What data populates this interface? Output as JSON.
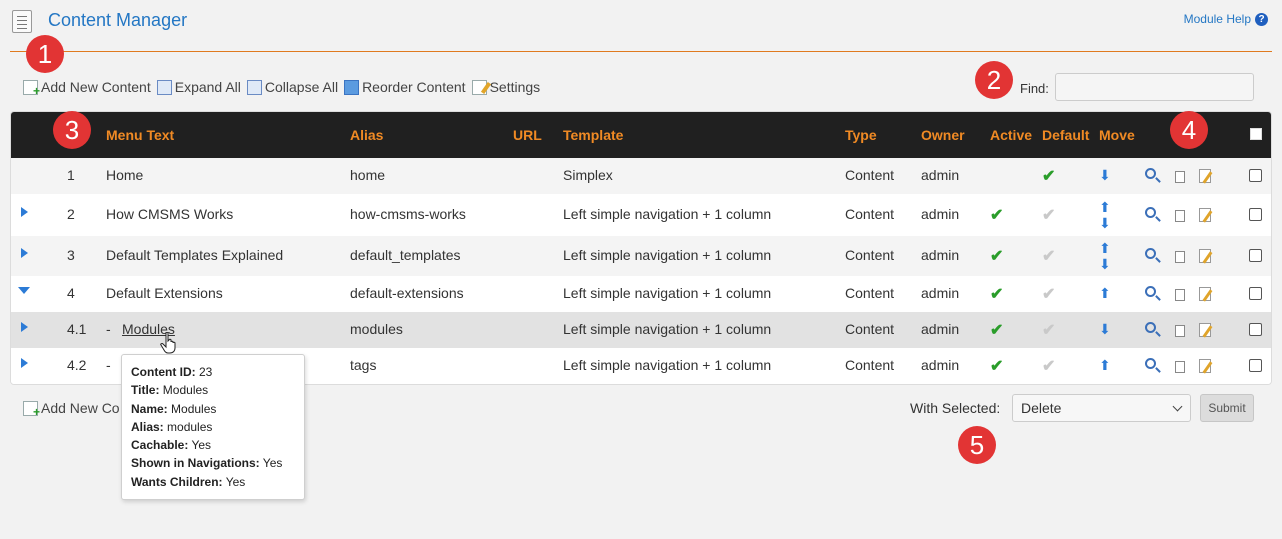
{
  "header": {
    "title": "Content Manager",
    "module_help": "Module Help",
    "help_icon": "?"
  },
  "callouts": [
    "1",
    "2",
    "3",
    "4",
    "5"
  ],
  "toolbar": {
    "add_new_content": "Add New Content",
    "expand_all": "Expand All",
    "collapse_all": "Collapse All",
    "reorder_content": "Reorder Content",
    "settings": "Settings"
  },
  "find": {
    "label": "Find:",
    "value": ""
  },
  "table": {
    "columns": [
      "Menu Text",
      "Alias",
      "URL",
      "Template",
      "Type",
      "Owner",
      "Active",
      "Default",
      "Move"
    ],
    "rows": [
      {
        "expander": "none",
        "num": "1",
        "prefix": "",
        "menu_text": "Home",
        "alias": "home",
        "template": "Simplex",
        "type": "Content",
        "owner": "admin",
        "active": "",
        "default": "on",
        "move": "down"
      },
      {
        "expander": "right",
        "num": "2",
        "prefix": "",
        "menu_text": "How CMSMS Works",
        "alias": "how-cmsms-works",
        "template": "Left simple navigation + 1 column",
        "type": "Content",
        "owner": "admin",
        "active": "on",
        "default": "off",
        "move": "updown"
      },
      {
        "expander": "right",
        "num": "3",
        "prefix": "",
        "menu_text": "Default Templates Explained",
        "alias": "default_templates",
        "template": "Left simple navigation + 1 column",
        "type": "Content",
        "owner": "admin",
        "active": "on",
        "default": "off",
        "move": "updown"
      },
      {
        "expander": "down",
        "num": "4",
        "prefix": "",
        "menu_text": "Default Extensions",
        "alias": "default-extensions",
        "template": "Left simple navigation + 1 column",
        "type": "Content",
        "owner": "admin",
        "active": "on",
        "default": "off",
        "move": "up"
      },
      {
        "expander": "right",
        "num": "4.1",
        "prefix": "-",
        "menu_text": "Modules",
        "alias": "modules",
        "template": "Left simple navigation + 1 column",
        "type": "Content",
        "owner": "admin",
        "active": "on",
        "default": "off",
        "move": "down"
      },
      {
        "expander": "right",
        "num": "4.2",
        "prefix": "-",
        "menu_text": "",
        "alias": "tags",
        "template": "Left simple navigation + 1 column",
        "type": "Content",
        "owner": "admin",
        "active": "on",
        "default": "off",
        "move": "up"
      }
    ]
  },
  "bottom": {
    "add_new_content": "Add New Co",
    "with_selected_label": "With Selected:",
    "with_selected_value": "Delete",
    "submit": "Submit"
  },
  "tooltip": {
    "lines": [
      {
        "label": "Content ID:",
        "value": "23"
      },
      {
        "label": "Title:",
        "value": "Modules"
      },
      {
        "label": "Name:",
        "value": "Modules"
      },
      {
        "label": "Alias:",
        "value": "modules"
      },
      {
        "label": "Cachable:",
        "value": "Yes"
      },
      {
        "label": "Shown in Navigations:",
        "value": "Yes"
      },
      {
        "label": "Wants Children:",
        "value": "Yes"
      }
    ]
  },
  "colors": {
    "accent_orange": "#f08a24",
    "link_blue": "#2477c4",
    "callout_red": "#e23434",
    "check_green": "#2a9d2a"
  }
}
